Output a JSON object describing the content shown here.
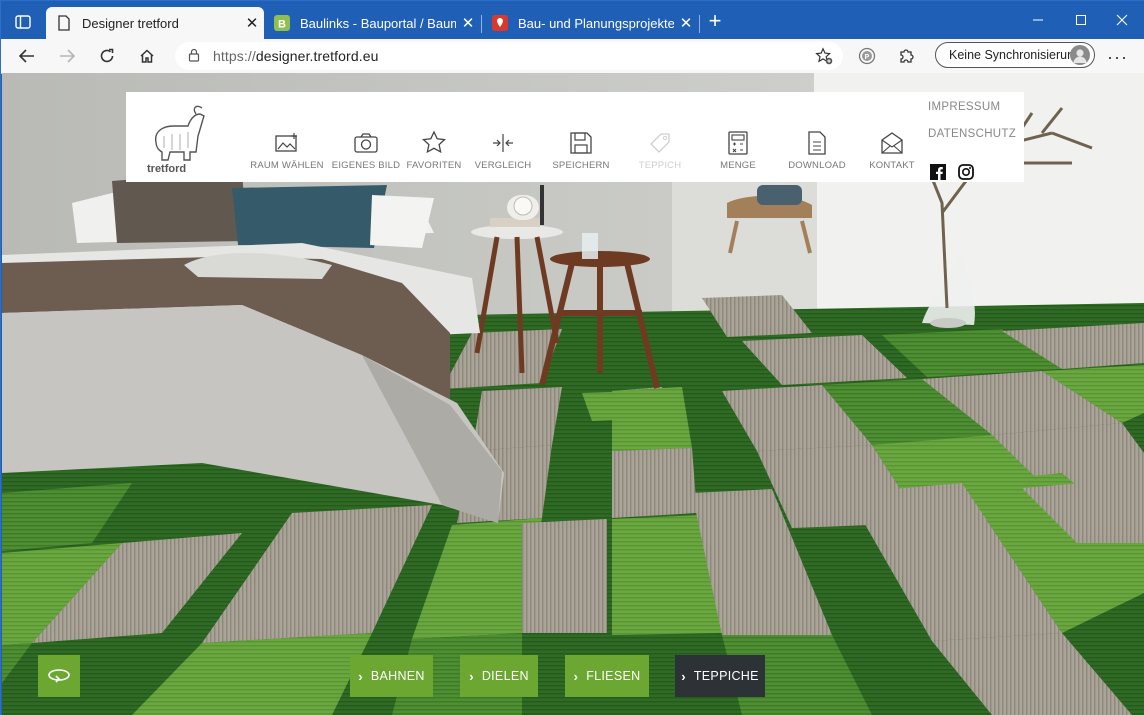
{
  "browser": {
    "tabs": [
      {
        "title": "Designer tretford",
        "active": true,
        "favicon": "page-icon"
      },
      {
        "title": "Baulinks - Bauportal / Baumagaz",
        "active": false,
        "favicon": "baulinks-icon"
      },
      {
        "title": "Bau- und Planungsprojekte auf I",
        "active": false,
        "favicon": "map-pin-icon"
      }
    ],
    "address": {
      "protocol": "https://",
      "host": "designer.tretford.eu"
    },
    "sync_label": "Keine Synchronisierung",
    "accent": "#1f5fb5"
  },
  "site": {
    "nav": [
      {
        "label": "RAUM WÄHLEN",
        "icon": "image-icon"
      },
      {
        "label": "EIGENES BILD",
        "icon": "camera-icon"
      },
      {
        "label": "FAVORITEN",
        "icon": "star-icon"
      },
      {
        "label": "VERGLEICH",
        "icon": "compare-icon"
      },
      {
        "label": "SPEICHERN",
        "icon": "save-icon"
      },
      {
        "label": "TEPPICH",
        "icon": "tag-icon",
        "disabled": true
      },
      {
        "label": "MENGE",
        "icon": "calculator-icon"
      },
      {
        "label": "DOWNLOAD",
        "icon": "document-icon"
      },
      {
        "label": "KONTAKT",
        "icon": "envelope-icon"
      }
    ],
    "side_links": [
      "IMPRESSUM",
      "DATENSCHUTZ"
    ],
    "logo_text": "tretford",
    "categories": [
      {
        "label": "BAHNEN",
        "active": false
      },
      {
        "label": "DIELEN",
        "active": false
      },
      {
        "label": "FLIESEN",
        "active": false
      },
      {
        "label": "TEPPICHE",
        "active": true
      }
    ],
    "colors": {
      "green": "#6ca732",
      "dark": "#2d3236"
    }
  }
}
